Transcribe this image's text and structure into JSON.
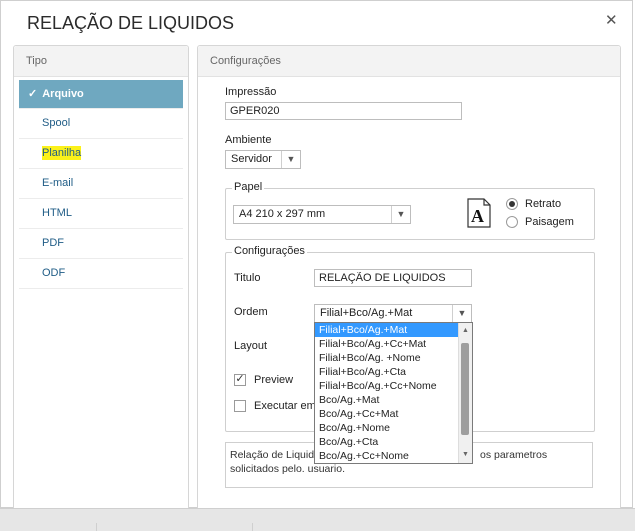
{
  "dialog": {
    "title": "RELAÇÃO DE LIQUIDOS",
    "close_glyph": "✕"
  },
  "tipo": {
    "header": "Tipo",
    "items": [
      {
        "label": "Arquivo",
        "selected": true,
        "icon": "check-icon",
        "check_glyph": "✓"
      },
      {
        "label": "Spool"
      },
      {
        "label": "Planilha",
        "highlighted": true
      },
      {
        "label": "E-mail"
      },
      {
        "label": "HTML"
      },
      {
        "label": "PDF"
      },
      {
        "label": "ODF"
      }
    ]
  },
  "config": {
    "header": "Configurações",
    "impressao_label": "Impressão",
    "impressao_value": "GPER020",
    "ambiente_label": "Ambiente",
    "ambiente_value": "Servidor",
    "papel_legend": "Papel",
    "papel_value": "A4 210 x 297 mm",
    "paper_icon_glyph": "A",
    "orientation": {
      "retrato": "Retrato",
      "paisagem": "Paisagem",
      "selected": "Retrato"
    },
    "config_legend": "Configurações",
    "titulo_label": "Titulo",
    "titulo_value": "RELAÇÃO DE LIQUIDOS",
    "ordem_label": "Ordem",
    "ordem_value": "Filial+Bco/Ag.+Mat",
    "layout_label": "Layout",
    "preview_label": "Preview",
    "preview_checked": true,
    "executar_label": "Executar em",
    "description": "Relação de Liquid",
    "description_tail": "os parametros",
    "description_line2": "solicitados pelo. usuario."
  },
  "ordem_options": [
    "Filial+Bco/Ag.+Mat",
    "Filial+Bco/Ag.+Cc+Mat",
    "Filial+Bco/Ag. +Nome",
    "Filial+Bco/Ag.+Cta",
    "Filial+Bco/Ag.+Cc+Nome",
    "Bco/Ag.+Mat",
    "Bco/Ag.+Cc+Mat",
    "Bco/Ag.+Nome",
    "Bco/Ag.+Cta",
    "Bco/Ag.+Cc+Nome"
  ],
  "ordem_selected_index": 0,
  "colors": {
    "selected_tab": "#6fa8c0",
    "link": "#1f5c86",
    "highlight": "#fbf11a",
    "dropdown_selection": "#3399ff"
  }
}
